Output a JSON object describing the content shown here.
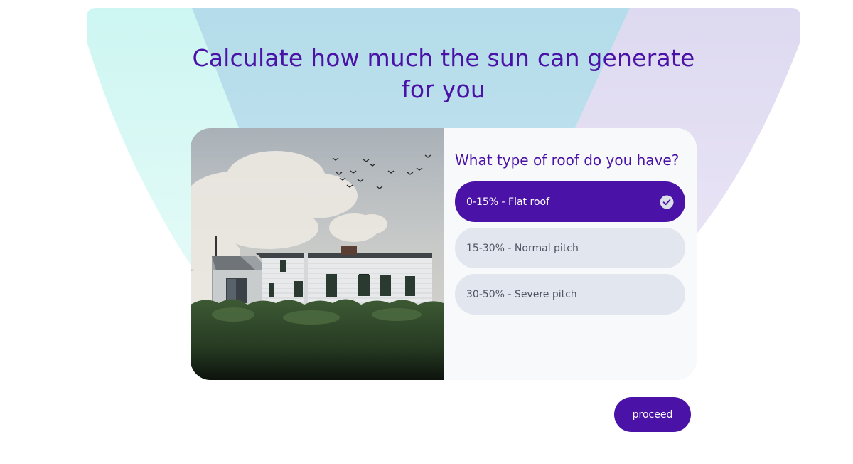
{
  "colors": {
    "brand": "#4a12a6",
    "option_bg": "#e2e7ef",
    "panel_bg": "#f8f9fb",
    "mint": "#d2f7f3",
    "sky": "#b9deeb",
    "lavender": "#e2dcf2"
  },
  "header": {
    "title": "Calculate how much the sun can generate for you"
  },
  "quiz": {
    "image_icon": "house-photo",
    "question": "What type of roof do you have?",
    "options": [
      {
        "label": "0-15% - Flat roof",
        "selected": true,
        "icon": "check-circle-icon"
      },
      {
        "label": "15-30% - Normal pitch",
        "selected": false
      },
      {
        "label": "30-50% - Severe pitch",
        "selected": false
      }
    ]
  },
  "actions": {
    "proceed_label": "proceed"
  }
}
